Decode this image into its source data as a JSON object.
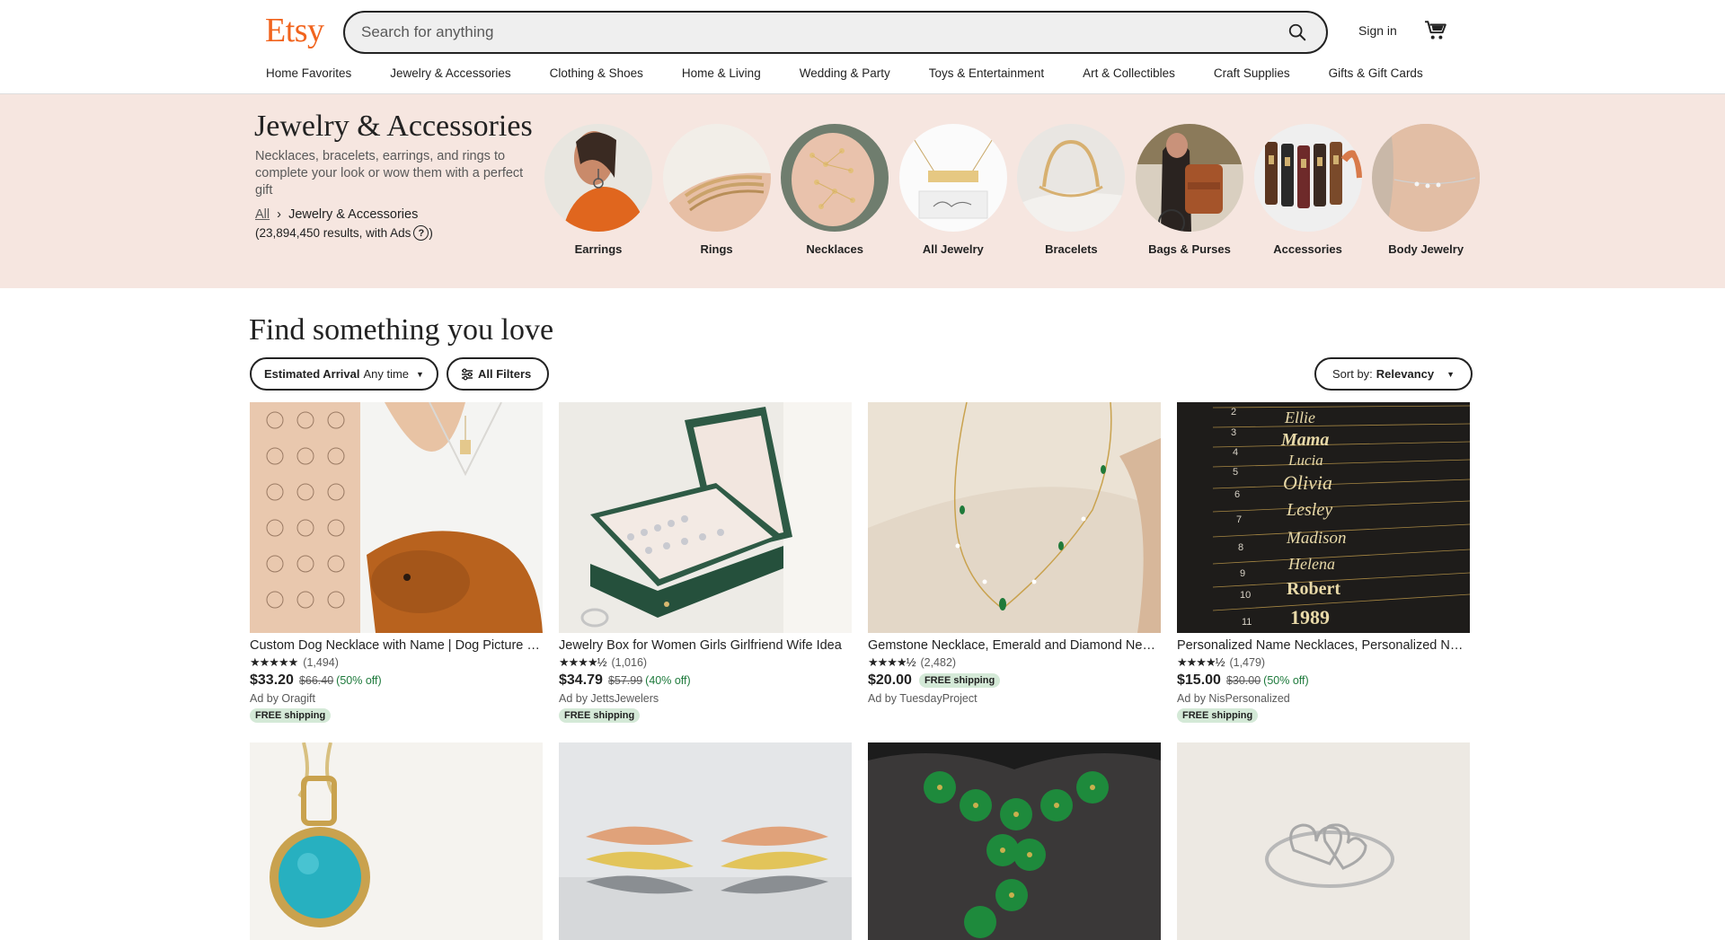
{
  "header": {
    "logo": "Etsy",
    "search_placeholder": "Search for anything",
    "signin": "Sign in"
  },
  "nav": [
    "Home Favorites",
    "Jewelry & Accessories",
    "Clothing & Shoes",
    "Home & Living",
    "Wedding & Party",
    "Toys & Entertainment",
    "Art & Collectibles",
    "Craft Supplies",
    "Gifts & Gift Cards"
  ],
  "hero": {
    "title": "Jewelry & Accessories",
    "description": "Necklaces, bracelets, earrings, and rings to complete your look or wow them with a perfect gift",
    "crumb_root": "All",
    "crumb_current": "Jewelry & Accessories",
    "results": "(23,894,450 results, with Ads",
    "results_close": ")",
    "qmark": "?",
    "categories": [
      "Earrings",
      "Rings",
      "Necklaces",
      "All Jewelry",
      "Bracelets",
      "Bags & Purses",
      "Accessories",
      "Body Jewelry"
    ]
  },
  "main": {
    "title": "Find something you love",
    "filter_arrival_label": "Estimated Arrival",
    "filter_arrival_value": "Any time",
    "filter_all": "All Filters",
    "sort_label": "Sort by:",
    "sort_value": "Relevancy"
  },
  "listings": [
    {
      "title": "Custom Dog Necklace with Name | Dog Picture Necklace",
      "stars": "★★★★★",
      "reviews": "(1,494)",
      "price": "$33.20",
      "original": "$66.40",
      "discount": "(50% off)",
      "shop": "Ad by Oragift",
      "shipping": "FREE shipping"
    },
    {
      "title": "Jewelry Box for Women Girls Girlfriend Wife Idea",
      "stars": "★★★★½",
      "reviews": "(1,016)",
      "price": "$34.79",
      "original": "$57.99",
      "discount": "(40% off)",
      "shop": "Ad by JettsJewelers",
      "shipping": "FREE shipping"
    },
    {
      "title": "Gemstone Necklace, Emerald and Diamond Necklace",
      "stars": "★★★★½",
      "reviews": "(2,482)",
      "price": "$20.00",
      "original": "",
      "discount": "",
      "shop": "Ad by TuesdayProject",
      "shipping": "FREE shipping"
    },
    {
      "title": "Personalized Name Necklaces, Personalized Name",
      "stars": "★★★★½",
      "reviews": "(1,479)",
      "price": "$15.00",
      "original": "$30.00",
      "discount": "(50% off)",
      "shop": "Ad by NisPersonalized",
      "shipping": "FREE shipping"
    }
  ],
  "name_image_text": [
    "2",
    "3",
    "4",
    "5",
    "6",
    "7",
    "8",
    "9",
    "10",
    "11",
    "Ellie",
    "Mama",
    "Lucia",
    "Olivia",
    "Lesley",
    "Madison",
    "Helena",
    "Robert",
    "1989"
  ],
  "colors": {
    "brand": "#F1641E",
    "hero_bg": "#F6E6E0",
    "free_badge": "#D4E9D7",
    "discount": "#1E7A3C"
  }
}
